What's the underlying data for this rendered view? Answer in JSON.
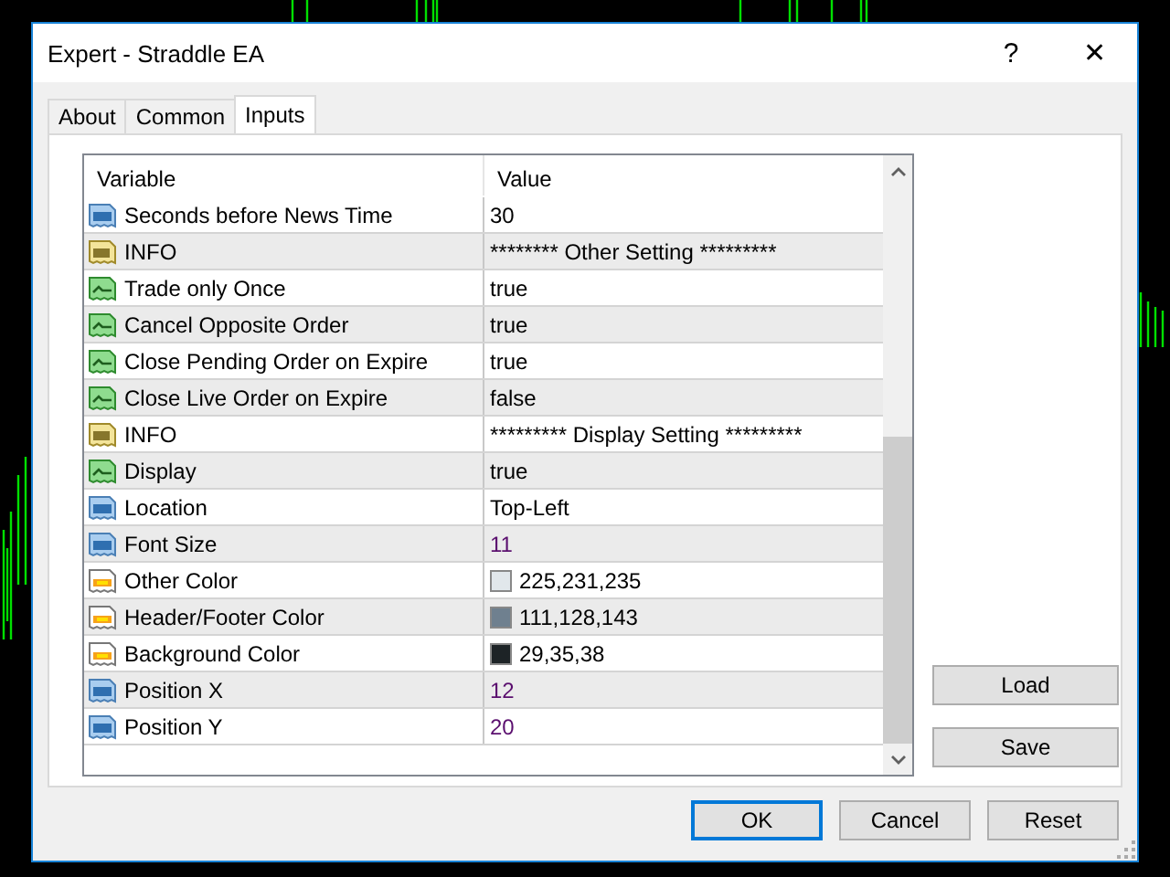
{
  "window": {
    "title": "Expert - Straddle EA",
    "help": "?",
    "close": "✕"
  },
  "tabs": [
    {
      "label": "About",
      "selected": false
    },
    {
      "label": "Common",
      "selected": false
    },
    {
      "label": "Inputs",
      "selected": true
    }
  ],
  "table": {
    "columns": [
      "Variable",
      "Value"
    ],
    "rows": [
      {
        "kind": "number",
        "variable": "Seconds before News Time",
        "value": "30",
        "modified": false
      },
      {
        "kind": "text",
        "variable": "INFO",
        "value": "******** Other Setting *********"
      },
      {
        "kind": "bool",
        "variable": "Trade only Once",
        "value": "true"
      },
      {
        "kind": "bool",
        "variable": "Cancel Opposite Order",
        "value": "true"
      },
      {
        "kind": "bool",
        "variable": "Close Pending Order on Expire",
        "value": "true"
      },
      {
        "kind": "bool",
        "variable": "Close Live Order on Expire",
        "value": "false"
      },
      {
        "kind": "text",
        "variable": "INFO",
        "value": "********* Display Setting *********"
      },
      {
        "kind": "bool",
        "variable": "Display",
        "value": "true"
      },
      {
        "kind": "number",
        "variable": "Location",
        "value": "Top-Left"
      },
      {
        "kind": "number",
        "variable": "Font Size",
        "value": "11",
        "modified": true
      },
      {
        "kind": "color",
        "variable": "Other Color",
        "value": "225,231,235",
        "color": "#e1e7eb"
      },
      {
        "kind": "color",
        "variable": "Header/Footer Color",
        "value": "111,128,143",
        "color": "#6f808f"
      },
      {
        "kind": "color",
        "variable": "Background Color",
        "value": "29,35,38",
        "color": "#1d2326"
      },
      {
        "kind": "number",
        "variable": "Position X",
        "value": "12",
        "modified": true
      },
      {
        "kind": "number",
        "variable": "Position Y",
        "value": "20",
        "modified": true
      }
    ]
  },
  "side_buttons": [
    "Load",
    "Save"
  ],
  "buttons": [
    {
      "label": "OK",
      "default": true
    },
    {
      "label": "Cancel",
      "default": false
    },
    {
      "label": "Reset",
      "default": false
    }
  ]
}
